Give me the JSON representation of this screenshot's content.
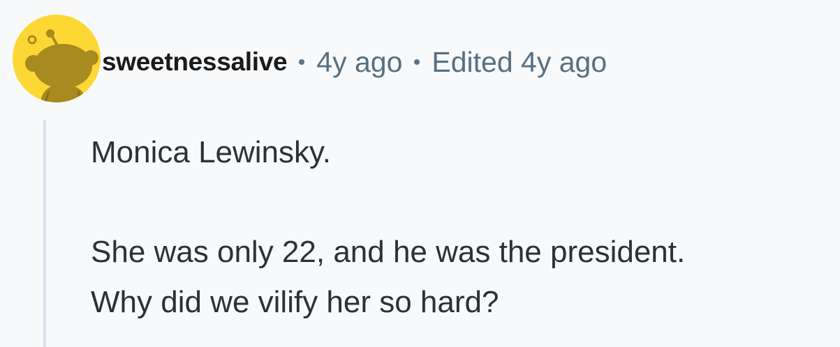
{
  "comment": {
    "avatar_icon": "reddit-snoo-icon",
    "avatar_color": "#fdd835",
    "username": "sweetnessalive",
    "posted": "4y ago",
    "edited": "Edited 4y ago",
    "body": {
      "paragraph1": "Monica Lewinsky.",
      "paragraph2_line1": "She was only 22, and he was the president.",
      "paragraph2_line2": "Why did we vilify her so hard?"
    }
  }
}
